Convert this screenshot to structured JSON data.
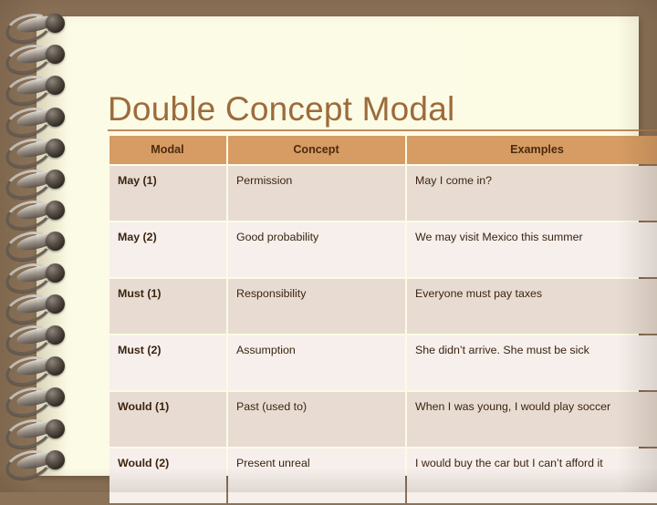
{
  "slide": {
    "background_color": "#8C7358",
    "page_color": "#FCFBE4",
    "accent_color": "#9C6B3C",
    "header_color": "#D79C63",
    "row_dark_color": "#E8DCD2",
    "row_light_color": "#F6EFEB"
  },
  "title": "Double Concept Modal",
  "table": {
    "headers": {
      "modal": "Modal",
      "concept": "Concept",
      "examples": "Examples"
    },
    "rows": [
      {
        "modal": "May (1)",
        "concept": "Permission",
        "example": "May I come in?"
      },
      {
        "modal": "May (2)",
        "concept": "Good probability",
        "example": "We may visit Mexico this summer"
      },
      {
        "modal": "Must (1)",
        "concept": "Responsibility",
        "example": "Everyone must pay taxes"
      },
      {
        "modal": "Must (2)",
        "concept": "Assumption",
        "example": "She didn’t arrive. She must be sick"
      },
      {
        "modal": "Would (1)",
        "concept": "Past (used to)",
        "example": "When  I was young, I would play soccer"
      },
      {
        "modal": "Would (2)",
        "concept": "Present unreal",
        "example": "I would buy the car but I can’t afford it"
      }
    ]
  },
  "binding": {
    "icon": "spiral-binding-icon",
    "coil_count": 15
  }
}
